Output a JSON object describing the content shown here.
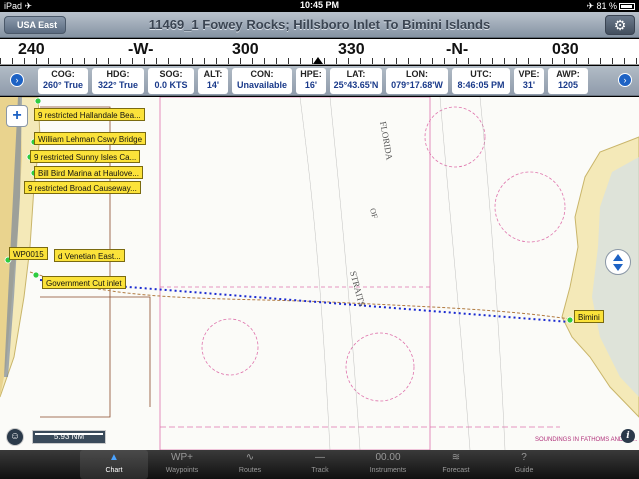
{
  "status": {
    "left": "iPad ✈",
    "time": "10:45 PM",
    "right": "✈ 81 %"
  },
  "nav": {
    "back_label": "USA East",
    "title": "11469_1 Fowey Rocks; Hillsboro Inlet To Bimini Islands",
    "gear_icon": "gear-icon"
  },
  "compass": {
    "labels": [
      "240",
      "-W-",
      "300",
      "330",
      "-N-",
      "030"
    ]
  },
  "instruments": [
    {
      "label": "COG:",
      "value": "260° True"
    },
    {
      "label": "HDG:",
      "value": "322° True"
    },
    {
      "label": "SOG:",
      "value": "0.0 KTS"
    },
    {
      "label": "ALT:",
      "value": "14'"
    },
    {
      "label": "CON:",
      "value": "Unavailable"
    },
    {
      "label": "HPE:",
      "value": "16'"
    },
    {
      "label": "LAT:",
      "value": "25°43.65'N"
    },
    {
      "label": "LON:",
      "value": "079°17.68'W"
    },
    {
      "label": "UTC:",
      "value": "8:46:05 PM"
    },
    {
      "label": "VPE:",
      "value": "31'"
    },
    {
      "label": "AWP:",
      "value": "1205"
    }
  ],
  "chart": {
    "waypoints": [
      "9 restricted Hallandale Bea...",
      "William Lehman Cswy Bridge",
      "9 restricted Sunny Isles Ca...",
      "Bill Bird Marina at Haulove...",
      "9 restricted Broad Causeway...",
      "WP0015",
      "d Venetian East...",
      "Government Cut inlet",
      "Bimini"
    ],
    "map_text": [
      "FLORIDA",
      "OF",
      "STRAITS"
    ],
    "scale": "5.93 NM",
    "zoom_label": "+",
    "note": "SOUNDINGS IN FATHOMS AND FE..."
  },
  "tabs": [
    {
      "label": "Chart",
      "icon": "▲"
    },
    {
      "label": "Waypoints",
      "icon": "WP+"
    },
    {
      "label": "Routes",
      "icon": "∿"
    },
    {
      "label": "Track",
      "icon": "—"
    },
    {
      "label": "Instruments",
      "icon": "00.00"
    },
    {
      "label": "Forecast",
      "icon": "≋"
    },
    {
      "label": "Guide",
      "icon": "?"
    }
  ]
}
